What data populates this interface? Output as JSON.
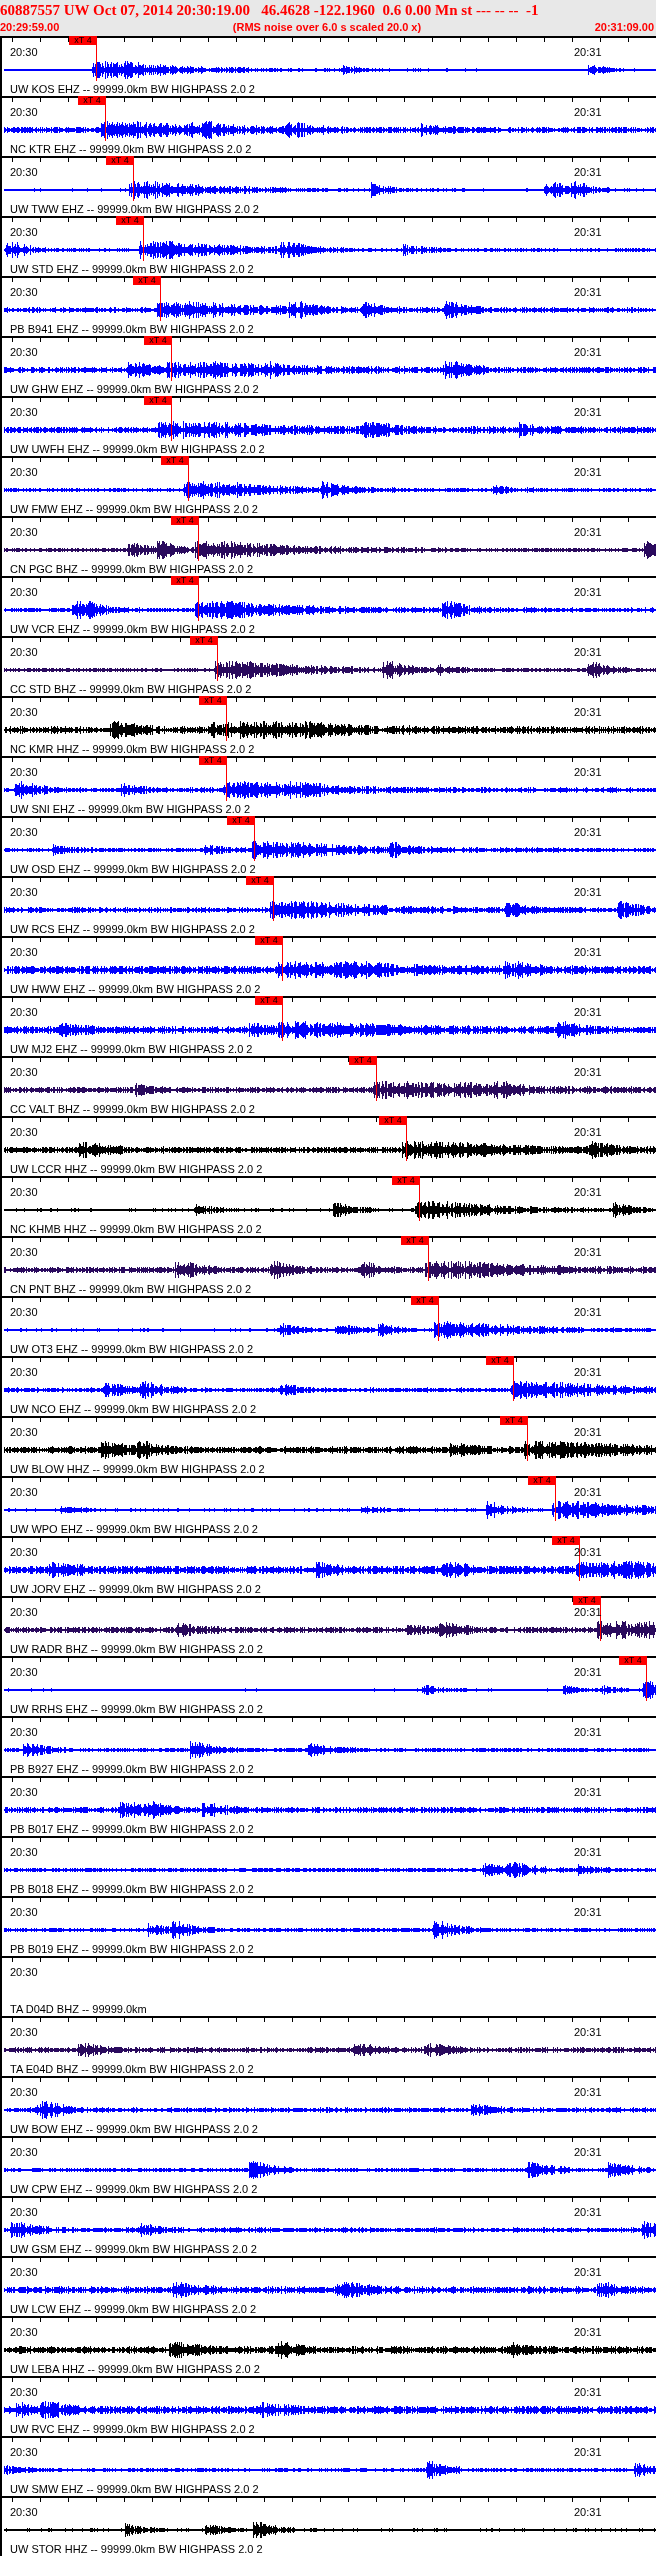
{
  "header": {
    "title": "60887557 UW Oct 07, 2014 20:30:19.00   46.4628 -122.1960  0.6 0.00 Mn st --- -- --  -1",
    "start_time": "20:29:59.00",
    "note": "(RMS noise over 6.0 s scaled 20.0 x)",
    "end_time": "20:31:09.00"
  },
  "traces": [
    {
      "kind": "waveform",
      "start_label": "20:30",
      "end_label": "20:31",
      "label": "UW KOS EHZ -- 99999.0km BW HIGHPASS 2.0 2",
      "color": "#0000ff",
      "pick": {
        "label": "xT 4",
        "level": 0.143
      }
    },
    {
      "kind": "waveform",
      "start_label": "20:30",
      "end_label": "20:31",
      "label": "NC KTR EHZ -- 99999.0km BW HIGHPASS 2.0 2",
      "color": "#0000ff",
      "pick": {
        "label": "xT 4",
        "level": 0.157
      }
    },
    {
      "kind": "waveform",
      "start_label": "20:30",
      "end_label": "20:31",
      "label": "UW TWW EHZ -- 99999.0km BW HIGHPASS 2.0 2",
      "color": "#0000ff",
      "pick": {
        "label": "xT 4",
        "level": 0.2
      }
    },
    {
      "kind": "waveform",
      "start_label": "20:30",
      "end_label": "20:31",
      "label": "UW STD EHZ -- 99999.0km BW HIGHPASS 2.0 2",
      "color": "#0000ff",
      "pick": {
        "label": "xT 4",
        "level": 0.215
      }
    },
    {
      "kind": "waveform",
      "start_label": "20:30",
      "end_label": "20:31",
      "label": "PB B941 EHZ -- 99999.0km BW HIGHPASS 2.0 2",
      "color": "#0000ff",
      "pick": {
        "label": "xT 4",
        "level": 0.242
      }
    },
    {
      "kind": "waveform",
      "start_label": "20:30",
      "end_label": "20:31",
      "label": "UW GHW EHZ -- 99999.0km BW HIGHPASS 2.0 2",
      "color": "#0000ff",
      "pick": {
        "label": "xT 4",
        "level": 0.258
      }
    },
    {
      "kind": "waveform",
      "start_label": "20:30",
      "end_label": "20:31",
      "label": "UW UWFH EHZ -- 99999.0km BW HIGHPASS 2.0 2",
      "color": "#0000ff",
      "pick": {
        "label": "xT 4",
        "level": 0.258
      }
    },
    {
      "kind": "waveform",
      "start_label": "20:30",
      "end_label": "20:31",
      "label": "UW FMW EHZ -- 99999.0km BW HIGHPASS 2.0 2",
      "color": "#0000ff",
      "pick": {
        "label": "xT 4",
        "level": 0.285
      }
    },
    {
      "kind": "waveform",
      "start_label": "20:30",
      "end_label": "20:31",
      "label": "CN PGC BHZ -- 99999.0km BW HIGHPASS 2.0 2",
      "color": "#2a0a5e",
      "pick": {
        "label": "xT 4",
        "level": 0.3
      }
    },
    {
      "kind": "waveform",
      "start_label": "20:30",
      "end_label": "20:31",
      "label": "UW VCR EHZ -- 99999.0km BW HIGHPASS 2.0 2",
      "color": "#0000ff",
      "pick": {
        "label": "xT 4",
        "level": 0.3
      }
    },
    {
      "kind": "waveform",
      "start_label": "20:30",
      "end_label": "20:31",
      "label": "CC STD BHZ -- 99999.0km BW HIGHPASS 2.0 2",
      "color": "#2a0a5e",
      "pick": {
        "label": "xT 4",
        "level": 0.329
      }
    },
    {
      "kind": "waveform",
      "start_label": "20:30",
      "end_label": "20:31",
      "label": "NC KMR HHZ -- 99999.0km BW HIGHPASS 2.0 2",
      "color": "#000000",
      "pick": {
        "label": "xT 4",
        "level": 0.343
      }
    },
    {
      "kind": "waveform",
      "start_label": "20:30",
      "end_label": "20:31",
      "label": "UW SNI EHZ -- 99999.0km BW HIGHPASS 2.0 2",
      "color": "#0000ff",
      "pick": {
        "label": "xT 4",
        "level": 0.343
      }
    },
    {
      "kind": "waveform",
      "start_label": "20:30",
      "end_label": "20:31",
      "label": "UW OSD EHZ -- 99999.0km BW HIGHPASS 2.0 2",
      "color": "#0000ff",
      "pick": {
        "label": "xT 4",
        "level": 0.386
      }
    },
    {
      "kind": "waveform",
      "start_label": "20:30",
      "end_label": "20:31",
      "label": "UW RCS EHZ -- 99999.0km BW HIGHPASS 2.0 2",
      "color": "#0000ff",
      "pick": {
        "label": "xT 4",
        "level": 0.415
      }
    },
    {
      "kind": "waveform",
      "start_label": "20:30",
      "end_label": "20:31",
      "label": "UW HWW EHZ -- 99999.0km BW HIGHPASS 2.0 2",
      "color": "#0000ff",
      "pick": {
        "label": "xT 4",
        "level": 0.428
      }
    },
    {
      "kind": "waveform",
      "start_label": "20:30",
      "end_label": "20:31",
      "label": "UW MJ2 EHZ -- 99999.0km BW HIGHPASS 2.0 2",
      "color": "#0000ff",
      "pick": {
        "label": "xT 4",
        "level": 0.428
      }
    },
    {
      "kind": "waveform",
      "start_label": "20:30",
      "end_label": "20:31",
      "label": "CC VALT BHZ -- 99999.0km BW HIGHPASS 2.0 2",
      "color": "#2a0a5e",
      "pick": {
        "label": "xT 4",
        "level": 0.572
      }
    },
    {
      "kind": "waveform",
      "start_label": "20:30",
      "end_label": "20:31",
      "label": "UW LCCR HHZ -- 99999.0km BW HIGHPASS 2.0 2",
      "color": "#000000",
      "pick": {
        "label": "xT 4",
        "level": 0.617
      }
    },
    {
      "kind": "waveform",
      "start_label": "20:30",
      "end_label": "20:31",
      "label": "NC KHMB HHZ -- 99999.0km BW HIGHPASS 2.0 2",
      "color": "#000000",
      "pick": {
        "label": "xT 4",
        "level": 0.637
      }
    },
    {
      "kind": "waveform",
      "start_label": "20:30",
      "end_label": "20:31",
      "label": "CN PNT BHZ -- 99999.0km BW HIGHPASS 2.0 2",
      "color": "#2a0a5e",
      "pick": {
        "label": "xT 4",
        "level": 0.652
      }
    },
    {
      "kind": "waveform",
      "start_label": "20:30",
      "end_label": "20:31",
      "label": "UW OT3 EHZ -- 99999.0km BW HIGHPASS 2.0 2",
      "color": "#0000ff",
      "pick": {
        "label": "xT 4",
        "level": 0.666
      }
    },
    {
      "kind": "waveform",
      "start_label": "20:30",
      "end_label": "20:31",
      "label": "UW NCO EHZ -- 99999.0km BW HIGHPASS 2.0 2",
      "color": "#0000ff",
      "pick": {
        "label": "xT 4",
        "level": 0.782
      }
    },
    {
      "kind": "waveform",
      "start_label": "20:30",
      "end_label": "20:31",
      "label": "UW BLOW HHZ -- 99999.0km BW HIGHPASS 2.0 2",
      "color": "#000000",
      "pick": {
        "label": "xT 4",
        "level": 0.803
      }
    },
    {
      "kind": "waveform",
      "start_label": "20:30",
      "end_label": "20:31",
      "label": "UW WPO EHZ -- 99999.0km BW HIGHPASS 2.0 2",
      "color": "#0000ff",
      "pick": {
        "label": "xT 4",
        "level": 0.846
      }
    },
    {
      "kind": "waveform",
      "start_label": "20:30",
      "end_label": "20:31",
      "label": "UW JORV EHZ -- 99999.0km BW HIGHPASS 2.0 2",
      "color": "#0000ff",
      "pick": {
        "label": "xT 4",
        "level": 0.883
      }
    },
    {
      "kind": "waveform",
      "start_label": "20:30",
      "end_label": "20:31",
      "label": "UW RADR BHZ -- 99999.0km BW HIGHPASS 2.0 2",
      "color": "#2a0a5e",
      "pick": {
        "label": "xT 4",
        "level": 0.915
      }
    },
    {
      "kind": "waveform",
      "start_label": "20:30",
      "end_label": "20:31",
      "label": "UW RRHS EHZ -- 99999.0km BW HIGHPASS 2.0 2",
      "color": "#0000ff",
      "pick": {
        "label": "xT 4",
        "level": 0.985
      }
    },
    {
      "kind": "waveform",
      "start_label": "20:30",
      "end_label": "20:31",
      "label": "PB B927 EHZ -- 99999.0km BW HIGHPASS 2.0 2",
      "color": "#0000ff"
    },
    {
      "kind": "waveform",
      "start_label": "20:30",
      "end_label": "20:31",
      "label": "PB B017 EHZ -- 99999.0km BW HIGHPASS 2.0 2",
      "color": "#0000ff"
    },
    {
      "kind": "waveform",
      "start_label": "20:30",
      "end_label": "20:31",
      "label": "PB B018 EHZ -- 99999.0km BW HIGHPASS 2.0 2",
      "color": "#0000ff"
    },
    {
      "kind": "waveform",
      "start_label": "20:30",
      "end_label": "20:31",
      "label": "PB B019 EHZ -- 99999.0km BW HIGHPASS 2.0 2",
      "color": "#0000ff"
    },
    {
      "kind": "empty",
      "start_label": "20:30",
      "label": "TA D04D BHZ -- 99999.0km"
    },
    {
      "kind": "waveform",
      "start_label": "20:30",
      "end_label": "20:31",
      "label": "TA E04D BHZ -- 99999.0km BW HIGHPASS 2.0 2",
      "color": "#2a0a5e"
    },
    {
      "kind": "waveform",
      "start_label": "20:30",
      "end_label": "20:31",
      "label": "UW BOW EHZ -- 99999.0km BW HIGHPASS 2.0 2",
      "color": "#0000ff"
    },
    {
      "kind": "waveform",
      "start_label": "20:30",
      "end_label": "20:31",
      "label": "UW CPW EHZ -- 99999.0km BW HIGHPASS 2.0 2",
      "color": "#0000ff"
    },
    {
      "kind": "waveform",
      "start_label": "20:30",
      "end_label": "20:31",
      "label": "UW GSM EHZ -- 99999.0km BW HIGHPASS 2.0 2",
      "color": "#0000ff"
    },
    {
      "kind": "waveform",
      "start_label": "20:30",
      "end_label": "20:31",
      "label": "UW LCW EHZ -- 99999.0km BW HIGHPASS 2.0 2",
      "color": "#0000ff"
    },
    {
      "kind": "waveform",
      "start_label": "20:30",
      "end_label": "20:31",
      "label": "UW LEBA HHZ -- 99999.0km BW HIGHPASS 2.0 2",
      "color": "#000000"
    },
    {
      "kind": "waveform",
      "start_label": "20:30",
      "end_label": "20:31",
      "label": "UW RVC EHZ -- 99999.0km BW HIGHPASS 2.0 2",
      "color": "#0000ff"
    },
    {
      "kind": "waveform",
      "start_label": "20:30",
      "end_label": "20:31",
      "label": "UW SMW EHZ -- 99999.0km BW HIGHPASS 2.0 2",
      "color": "#0000ff"
    },
    {
      "kind": "waveform",
      "start_label": "20:30",
      "end_label": "20:31",
      "label": "UW STOR HHZ -- 99999.0km BW HIGHPASS 2.0 2",
      "color": "#000000"
    }
  ]
}
